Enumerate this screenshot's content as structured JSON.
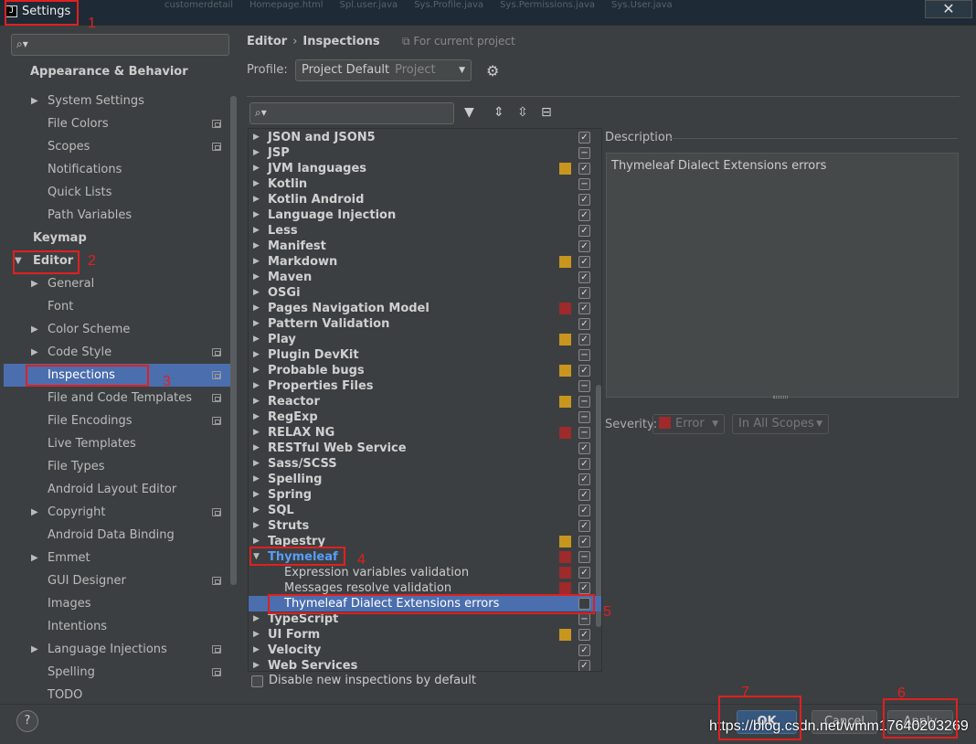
{
  "window": {
    "title": "Settings",
    "icon": "J",
    "close": "✕",
    "background_tabs": [
      "customerdetail",
      "Homepage.html",
      "Spl.user.java",
      "Sys.Profile.java",
      "Sys.Permissions.java",
      "Sys.User.java"
    ]
  },
  "sidebar": {
    "search_placeholder": "",
    "items": [
      {
        "label": "Appearance & Behavior",
        "bold": true
      },
      {
        "label": "System Settings",
        "arrow": true
      },
      {
        "label": "File Colors",
        "proj": true
      },
      {
        "label": "Scopes",
        "proj": true
      },
      {
        "label": "Notifications"
      },
      {
        "label": "Quick Lists"
      },
      {
        "label": "Path Variables"
      },
      {
        "label": "Keymap",
        "bold": true
      },
      {
        "label": "Editor",
        "bold": true,
        "expanded": true
      },
      {
        "label": "General",
        "arrow": true
      },
      {
        "label": "Font"
      },
      {
        "label": "Color Scheme",
        "arrow": true
      },
      {
        "label": "Code Style",
        "arrow": true,
        "proj": true
      },
      {
        "label": "Inspections",
        "proj": true,
        "selected": true
      },
      {
        "label": "File and Code Templates",
        "proj": true
      },
      {
        "label": "File Encodings",
        "proj": true
      },
      {
        "label": "Live Templates"
      },
      {
        "label": "File Types"
      },
      {
        "label": "Android Layout Editor"
      },
      {
        "label": "Copyright",
        "arrow": true,
        "proj": true
      },
      {
        "label": "Android Data Binding"
      },
      {
        "label": "Emmet",
        "arrow": true
      },
      {
        "label": "GUI Designer",
        "proj": true
      },
      {
        "label": "Images"
      },
      {
        "label": "Intentions"
      },
      {
        "label": "Language Injections",
        "arrow": true,
        "proj": true
      },
      {
        "label": "Spelling",
        "proj": true
      },
      {
        "label": "TODO"
      }
    ]
  },
  "breadcrumb": {
    "root": "Editor",
    "sep": "›",
    "current": "Inspections",
    "scope_note": "For current project"
  },
  "profile": {
    "label": "Profile:",
    "value": "Project Default",
    "sub": "Project"
  },
  "filter": {
    "placeholder": ""
  },
  "tree": [
    {
      "label": "JSON and JSON5",
      "check": "✓"
    },
    {
      "label": "JSP",
      "check": "−"
    },
    {
      "label": "JVM languages",
      "check": "✓",
      "sev": "#c8961e"
    },
    {
      "label": "Kotlin",
      "check": "−"
    },
    {
      "label": "Kotlin Android",
      "check": "✓"
    },
    {
      "label": "Language Injection",
      "check": "✓"
    },
    {
      "label": "Less",
      "check": "✓"
    },
    {
      "label": "Manifest",
      "check": "✓"
    },
    {
      "label": "Markdown",
      "check": "✓",
      "sev": "#c8961e"
    },
    {
      "label": "Maven",
      "check": "✓"
    },
    {
      "label": "OSGi",
      "check": "✓"
    },
    {
      "label": "Pages Navigation Model",
      "check": "✓",
      "sev": "#9e2a2b"
    },
    {
      "label": "Pattern Validation",
      "check": "✓"
    },
    {
      "label": "Play",
      "check": "✓",
      "sev": "#c8961e"
    },
    {
      "label": "Plugin DevKit",
      "check": "−"
    },
    {
      "label": "Probable bugs",
      "check": "✓",
      "sev": "#c8961e"
    },
    {
      "label": "Properties Files",
      "check": "−"
    },
    {
      "label": "Reactor",
      "check": "−",
      "sev": "#c8961e"
    },
    {
      "label": "RegExp",
      "check": "−"
    },
    {
      "label": "RELAX NG",
      "check": "−",
      "sev": "#9e2a2b"
    },
    {
      "label": "RESTful Web Service",
      "check": "✓"
    },
    {
      "label": "Sass/SCSS",
      "check": "✓"
    },
    {
      "label": "Spelling",
      "check": "✓"
    },
    {
      "label": "Spring",
      "check": "✓"
    },
    {
      "label": "SQL",
      "check": "✓"
    },
    {
      "label": "Struts",
      "check": "✓"
    },
    {
      "label": "Tapestry",
      "check": "✓",
      "sev": "#c8961e"
    },
    {
      "label": "Thymeleaf",
      "check": "−",
      "sev": "#9e2a2b",
      "expanded": true,
      "thy": true
    },
    {
      "label": "Expression variables validation",
      "check": "✓",
      "sev": "#9e2a2b",
      "child": true
    },
    {
      "label": "Messages resolve validation",
      "check": "✓",
      "sev": "#9e2a2b",
      "child": true
    },
    {
      "label": "Thymeleaf Dialect Extensions errors",
      "check": "",
      "child": true,
      "selected": true
    },
    {
      "label": "TypeScript",
      "check": "−"
    },
    {
      "label": "UI Form",
      "check": "✓",
      "sev": "#c8961e"
    },
    {
      "label": "Velocity",
      "check": "✓"
    },
    {
      "label": "Web Services",
      "check": "✓"
    }
  ],
  "disable_new": {
    "label": "Disable new inspections by default"
  },
  "description": {
    "label": "Description",
    "text": "Thymeleaf Dialect Extensions errors"
  },
  "severity": {
    "label": "Severity:",
    "value": "Error",
    "color": "#9e2a2b",
    "scope": "In All Scopes"
  },
  "buttons": {
    "ok": "OK",
    "cancel": "Cancel",
    "apply": "Apply",
    "help": "?"
  },
  "annotations": [
    "1",
    "2",
    "3",
    "4",
    "5",
    "6",
    "7"
  ],
  "watermark": "https://blog.csdn.net/wmm17640203269"
}
